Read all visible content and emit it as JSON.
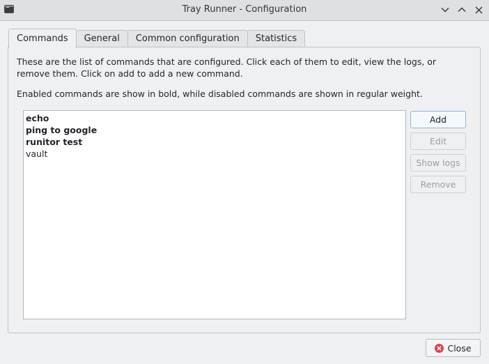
{
  "window": {
    "title": "Tray Runner - Configuration"
  },
  "tabs": [
    {
      "label": "Commands",
      "active": true
    },
    {
      "label": "General",
      "active": false
    },
    {
      "label": "Common configuration",
      "active": false
    },
    {
      "label": "Statistics",
      "active": false
    }
  ],
  "commands_tab": {
    "description_1": "These are the list of commands that are configured. Click each of them to edit, view the logs, or remove them. Click on add to add a new command.",
    "description_2": "Enabled commands are show in bold, while disabled commands are shown in regular weight.",
    "commands": [
      {
        "name": "echo",
        "enabled": true
      },
      {
        "name": "ping to google",
        "enabled": true
      },
      {
        "name": "runitor test",
        "enabled": true
      },
      {
        "name": "vault",
        "enabled": false
      }
    ],
    "buttons": {
      "add": "Add",
      "edit": "Edit",
      "show_logs": "Show logs",
      "remove": "Remove"
    }
  },
  "footer": {
    "close_label": "Close"
  },
  "icons": {
    "app": "terminal-icon",
    "minimize": "chevron-down-icon",
    "maximize": "chevron-up-icon",
    "close_window": "close-icon",
    "close_button": "close-circle-icon"
  },
  "colors": {
    "close_icon_red": "#da4453",
    "primary_button_border": "#8fb5d8"
  }
}
